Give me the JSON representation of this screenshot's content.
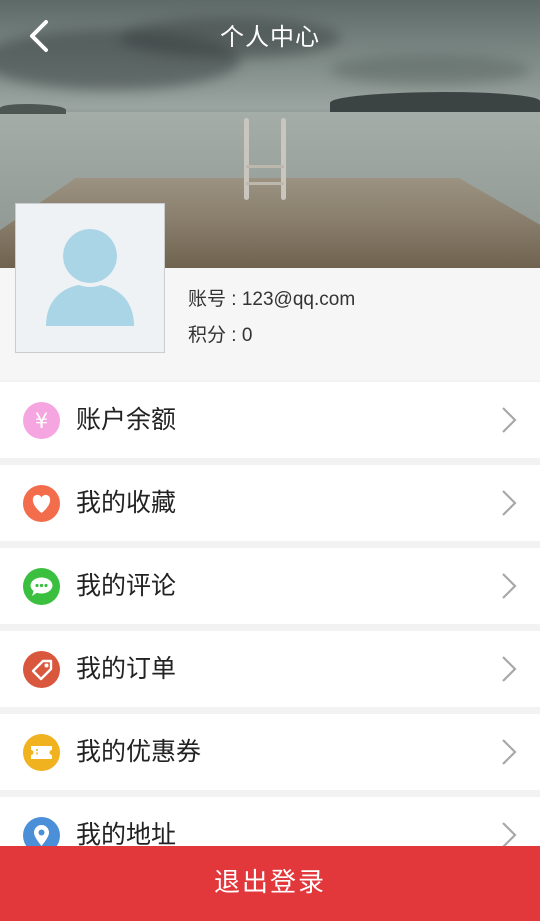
{
  "header": {
    "title": "个人中心",
    "back_icon": "back-arrow-icon"
  },
  "profile": {
    "account_label": "账号",
    "account_value": "123@qq.com",
    "points_label": "积分",
    "points_value": "0",
    "avatar_icon": "user-avatar-icon"
  },
  "menu": {
    "items": [
      {
        "label": "账户余额",
        "icon": "yen-icon",
        "icon_color": "#f5a6e0"
      },
      {
        "label": "我的收藏",
        "icon": "heart-icon",
        "icon_color": "#f36d4c"
      },
      {
        "label": "我的评论",
        "icon": "chat-icon",
        "icon_color": "#3bbf3e"
      },
      {
        "label": "我的订单",
        "icon": "tag-icon",
        "icon_color": "#d9573c"
      },
      {
        "label": "我的优惠券",
        "icon": "ticket-icon",
        "icon_color": "#f0b21f"
      },
      {
        "label": "我的地址",
        "icon": "location-pin-icon",
        "icon_color": "#4a8fd8"
      }
    ]
  },
  "footer": {
    "logout_label": "退出登录",
    "logout_color": "#e2383c"
  }
}
